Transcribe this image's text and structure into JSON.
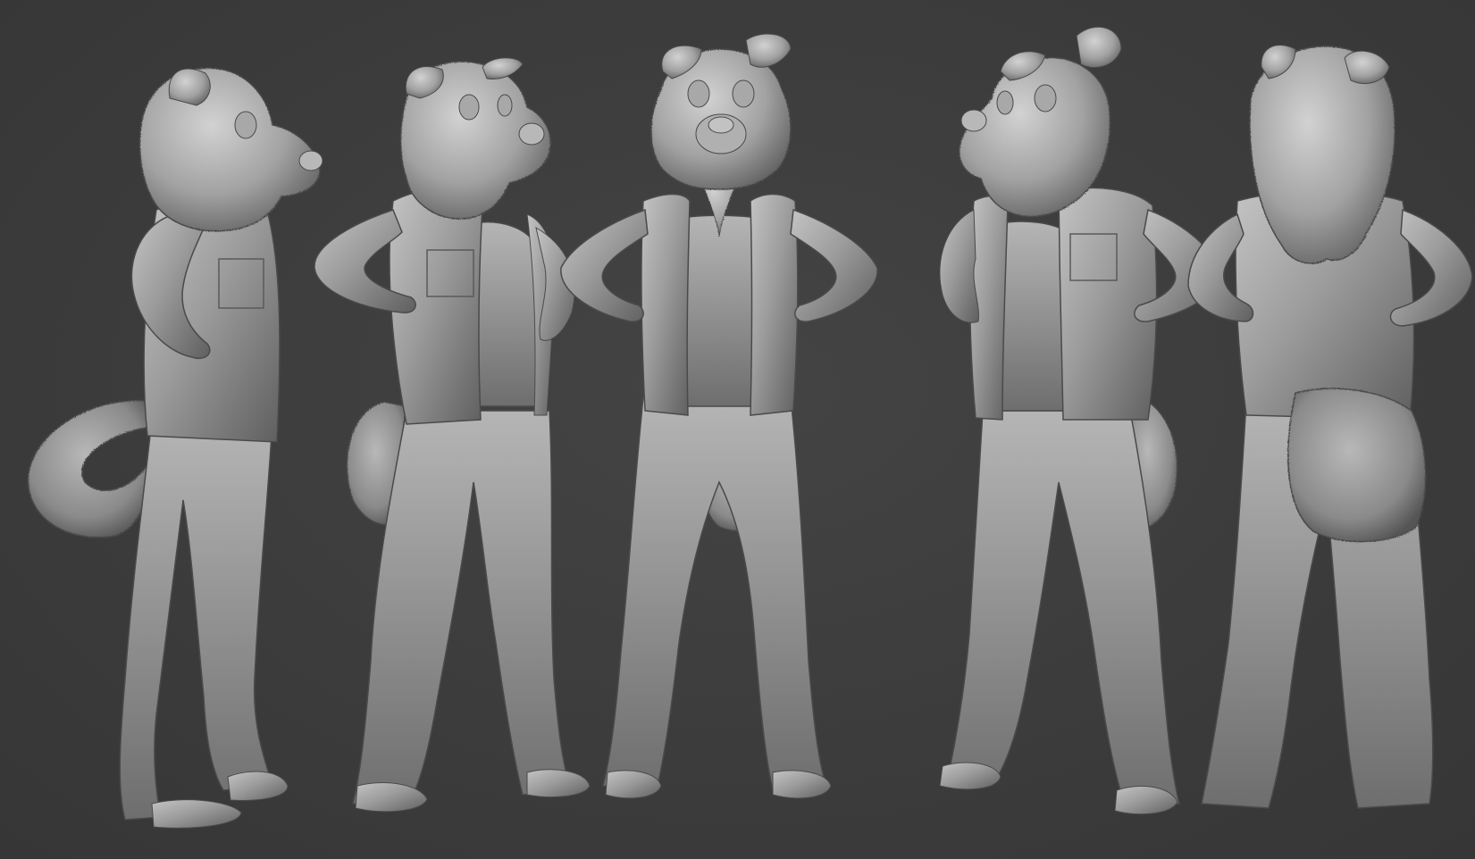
{
  "scene": {
    "background_color": "#3d3d3d",
    "clay_color": "#9a9a9a",
    "clay_highlight": "#c9c9c9",
    "clay_shadow": "#4e4e4e",
    "views": [
      {
        "name": "side-view-right",
        "icon": "turnaround-figure"
      },
      {
        "name": "three-quarter-view-right",
        "icon": "turnaround-figure"
      },
      {
        "name": "front-view",
        "icon": "turnaround-figure"
      },
      {
        "name": "three-quarter-view-left",
        "icon": "turnaround-figure"
      },
      {
        "name": "back-view",
        "icon": "turnaround-figure"
      }
    ]
  }
}
